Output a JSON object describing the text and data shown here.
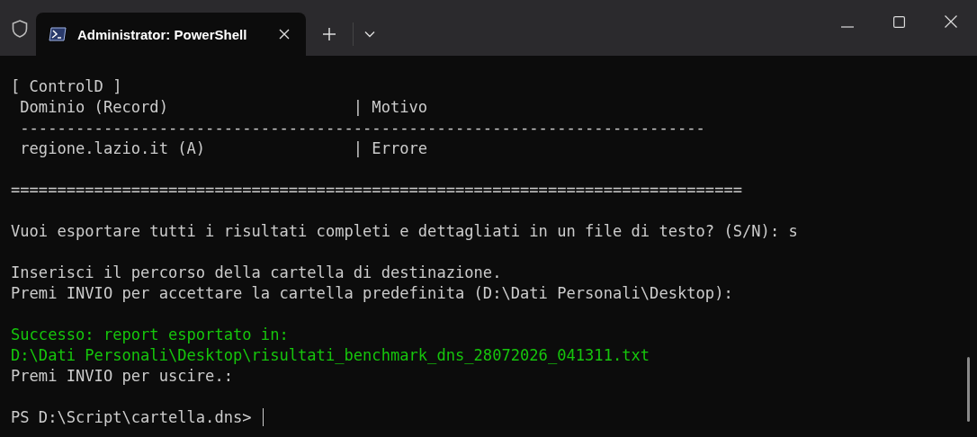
{
  "window": {
    "tabs": [
      {
        "title": "Administrator: PowerShell",
        "selected": true
      }
    ]
  },
  "terminal": {
    "lines": [
      {
        "kind": "text",
        "text": "[ ControlD ]"
      },
      {
        "kind": "text",
        "text": " Dominio (Record)                    | Motivo"
      },
      {
        "kind": "text",
        "text": " --------------------------------------------------------------------------"
      },
      {
        "kind": "text",
        "text": " regione.lazio.it (A)                | Errore"
      },
      {
        "kind": "blank"
      },
      {
        "kind": "text",
        "text": "==============================================================================="
      },
      {
        "kind": "blank"
      },
      {
        "kind": "text",
        "text": "Vuoi esportare tutti i risultati completi e dettagliati in un file di testo? (S/N): s"
      },
      {
        "kind": "blank"
      },
      {
        "kind": "text",
        "text": "Inserisci il percorso della cartella di destinazione."
      },
      {
        "kind": "text",
        "text": "Premi INVIO per accettare la cartella predefinita (D:\\Dati Personali\\Desktop):"
      },
      {
        "kind": "blank"
      },
      {
        "kind": "success",
        "text": "Successo: report esportato in:"
      },
      {
        "kind": "success",
        "text": "D:\\Dati Personali\\Desktop\\risultati_benchmark_dns_28072026_041311.txt"
      },
      {
        "kind": "text",
        "text": "Premi INVIO per uscire.:"
      },
      {
        "kind": "blank"
      },
      {
        "kind": "prompt",
        "text": "PS D:\\Script\\cartella.dns>"
      }
    ]
  }
}
